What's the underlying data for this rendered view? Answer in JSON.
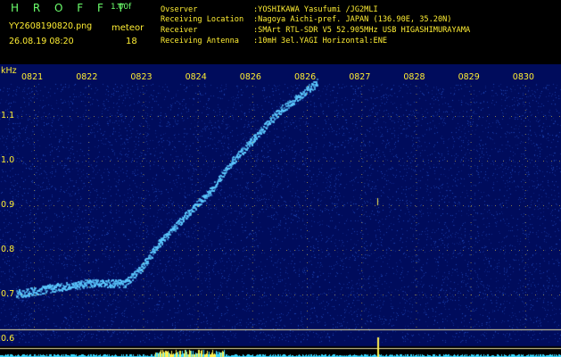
{
  "header": {
    "brand": "H R O F F T",
    "version": "1.00f",
    "filename": "YY2608190820.png",
    "datetime": "26.08.19 08:20",
    "meteor_label": "meteor",
    "meteor_count": "18"
  },
  "station": [
    {
      "key": "Ovserver",
      "value": ":YOSHIKAWA Yasufumi /JG2MLI"
    },
    {
      "key": "Receiving Location",
      "value": ":Nagoya Aichi-pref. JAPAN (136.90E, 35.20N)"
    },
    {
      "key": "Receiver",
      "value": ":SMArt RTL-SDR V5 52.905MHz USB HIGASHIMURAYAMA"
    },
    {
      "key": "Receiving Antenna",
      "value": ":10mH 3el.YAGI Horizontal:ENE"
    }
  ],
  "spectrogram": {
    "unit": "kHz",
    "time_ticks": [
      "0821",
      "0822",
      "0823",
      "0824",
      "0826",
      "0826",
      "0827",
      "0828",
      "0829",
      "0830"
    ],
    "freq_ticks": [
      {
        "label": "1.1",
        "khz": 1.1
      },
      {
        "label": "1.0",
        "khz": 1.0
      },
      {
        "label": "0.9",
        "khz": 0.9
      },
      {
        "label": "0.8",
        "khz": 0.8
      },
      {
        "label": "0.7",
        "khz": 0.7
      },
      {
        "label": "0.6",
        "khz": 0.6
      }
    ],
    "colors": {
      "background": "#000c5c",
      "noise": "#2a5bd8",
      "trace": "#5ac8ff",
      "grid_dots": "#e8d040",
      "band_lines": "#e8e0a0",
      "bottom_strip": "#3ad8ff",
      "strip_highlight": "#fff050",
      "label": "#ffee33"
    }
  }
}
